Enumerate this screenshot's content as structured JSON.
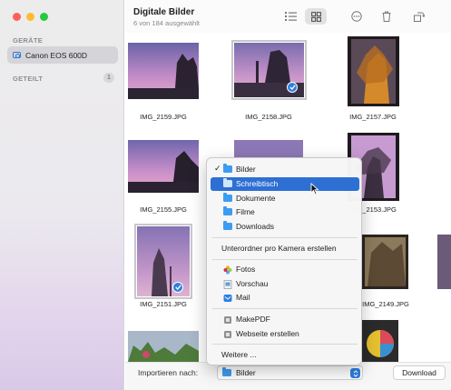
{
  "sidebar": {
    "section_devices": "GERÄTE",
    "device_name": "Canon EOS 600D",
    "section_shared": "GETEILT",
    "shared_count": "1"
  },
  "toolbar": {
    "title": "Digitale Bilder",
    "subtitle": "6 von 184 ausgewählt"
  },
  "images": [
    {
      "name": "IMG_2159.JPG"
    },
    {
      "name": "IMG_2158.JPG"
    },
    {
      "name": "IMG_2157.JPG"
    },
    {
      "name": "IMG_2155.JPG"
    },
    {
      "name": "IMG_2153.JPG"
    },
    {
      "name": "IMG_2151.JPG"
    },
    {
      "name": "IMG_2149.JPG"
    }
  ],
  "bottombar": {
    "import_label": "Importieren nach:",
    "selected_destination": "Bilder",
    "download_label": "Download"
  },
  "menu": {
    "folders": [
      "Bilder",
      "Schreibtisch",
      "Dokumente",
      "Filme",
      "Downloads"
    ],
    "checked_item": "Bilder",
    "highlighted_item": "Schreibtisch",
    "subfolder_option": "Unterordner pro Kamera erstellen",
    "apps": [
      "Fotos",
      "Vorschau",
      "Mail"
    ],
    "automations": [
      "MakePDF",
      "Webseite erstellen"
    ],
    "more": "Weitere ..."
  },
  "colors": {
    "accent": "#2e6fd3",
    "folder_blue": "#3d9cf0",
    "check_blue": "#2f7fe0"
  }
}
